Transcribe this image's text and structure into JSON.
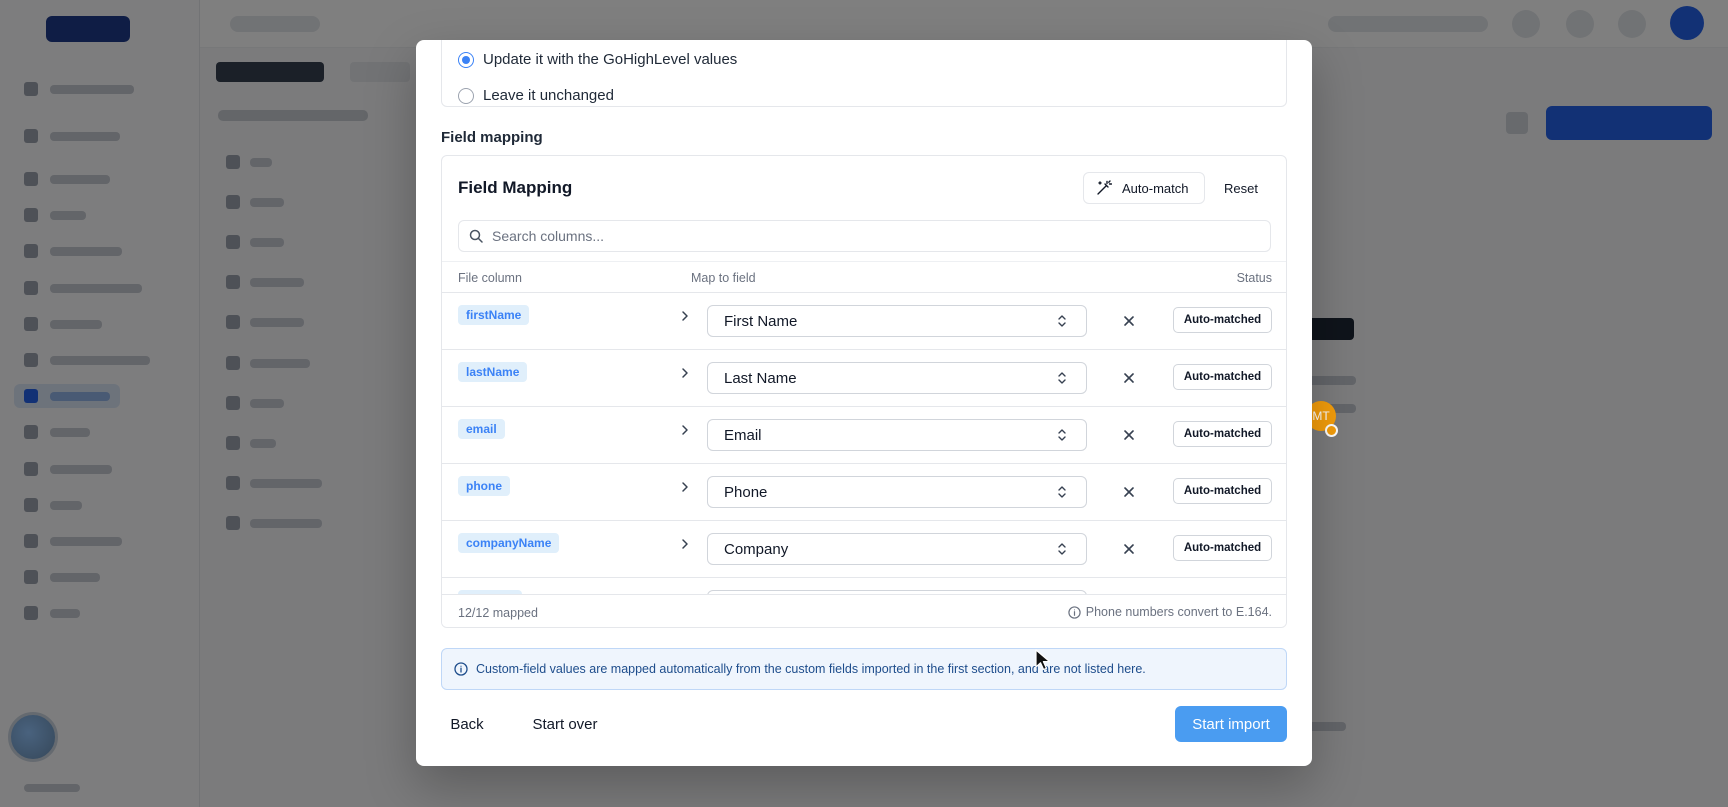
{
  "duplicate_options": {
    "option_update": "Update it with the GoHighLevel values",
    "option_leave": "Leave it unchanged",
    "selected": "update"
  },
  "section_label": "Field mapping",
  "field_mapping": {
    "title": "Field Mapping",
    "auto_match_label": "Auto-match",
    "reset_label": "Reset",
    "search_placeholder": "Search columns...",
    "columns": {
      "file_column": "File column",
      "map_to_field": "Map to field",
      "status": "Status"
    },
    "rows": [
      {
        "file_column": "firstName",
        "field": "First Name",
        "status": "Auto-matched"
      },
      {
        "file_column": "lastName",
        "field": "Last Name",
        "status": "Auto-matched"
      },
      {
        "file_column": "email",
        "field": "Email",
        "status": "Auto-matched"
      },
      {
        "file_column": "phone",
        "field": "Phone",
        "status": "Auto-matched"
      },
      {
        "file_column": "companyName",
        "field": "Company",
        "status": "Auto-matched"
      },
      {
        "file_column": "",
        "field": "",
        "status": ""
      }
    ],
    "mapped_count": "12/12 mapped",
    "phone_note": "Phone numbers convert to E.164."
  },
  "info_banner": "Custom-field values are mapped automatically from the custom fields imported in the first section, and are not listed here.",
  "footer": {
    "back_label": "Back",
    "start_over_label": "Start over",
    "start_import_label": "Start import"
  },
  "background": {
    "avatar_initials": "MT"
  },
  "colors": {
    "accent": "#4a9cf1",
    "badge_bg": "#e0effb",
    "badge_text": "#3b82f6",
    "banner_bg": "#eff5fd",
    "banner_text": "#1e4d8c"
  }
}
